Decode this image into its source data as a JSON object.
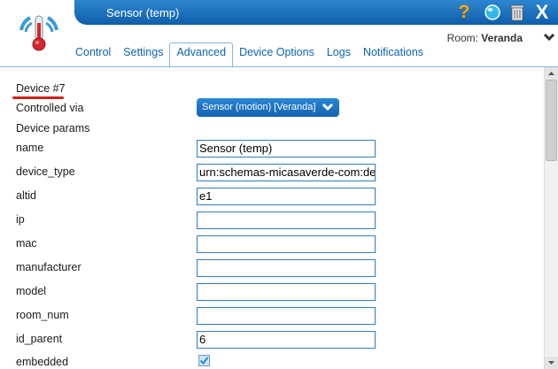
{
  "window": {
    "title": "Sensor (temp)"
  },
  "toolbar": {
    "help_icon": "question-mark-icon",
    "ball_icon": "blue-ball-icon",
    "trash_icon": "trash-can-icon",
    "close_icon": "close-x-icon",
    "close_glyph": "X",
    "help_glyph": "?"
  },
  "room": {
    "prefix": "Room:",
    "name": "Veranda"
  },
  "tabs": [
    {
      "label": "Control",
      "active": false
    },
    {
      "label": "Settings",
      "active": false
    },
    {
      "label": "Advanced",
      "active": true
    },
    {
      "label": "Device Options",
      "active": false
    },
    {
      "label": "Logs",
      "active": false
    },
    {
      "label": "Notifications",
      "active": false
    }
  ],
  "advanced": {
    "device_heading": "Device #7",
    "controlled_via_label": "Controlled via",
    "controlled_via_value": "Sensor (motion) [Veranda]",
    "device_params_label": "Device params",
    "params": [
      {
        "label": "name",
        "value": "Sensor (temp)"
      },
      {
        "label": "device_type",
        "value": "urn:schemas-micasaverde-com:de"
      },
      {
        "label": "altid",
        "value": "e1"
      },
      {
        "label": "ip",
        "value": ""
      },
      {
        "label": "mac",
        "value": ""
      },
      {
        "label": "manufacturer",
        "value": ""
      },
      {
        "label": "model",
        "value": ""
      },
      {
        "label": "room_num",
        "value": ""
      },
      {
        "label": "id_parent",
        "value": "6"
      }
    ],
    "embedded_label": "embedded",
    "embedded_checked": true
  },
  "colors": {
    "titlebar": "#1570c0",
    "tab_text": "#0b63b3",
    "field_border": "#2f7dc2",
    "underline": "#d21f1f"
  }
}
